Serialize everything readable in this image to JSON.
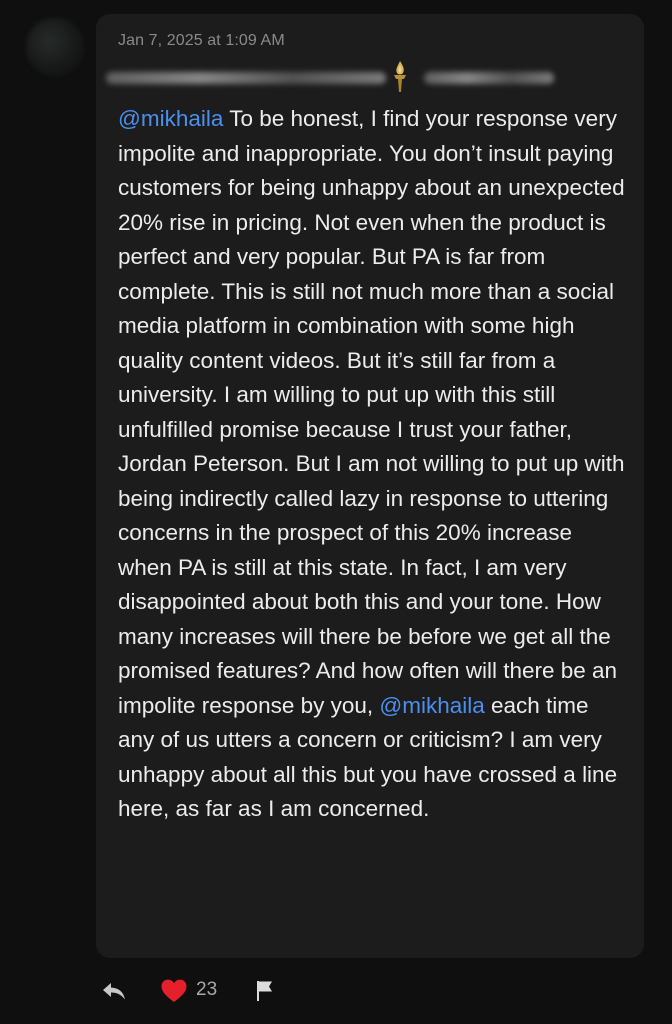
{
  "post": {
    "timestamp": "Jan 7, 2025 at 1:09 AM",
    "message": {
      "mention_1": "@mikhaila",
      "text_1": " To be honest, I find your response very impolite and inappropriate. You don’t insult paying customers for being unhappy about an unexpected 20% rise in pricing. Not even when the product is perfect and very popular. But PA is far from complete. This is still not much more than a social media platform in combination with some high quality content videos. But it’s still far from a university. I am willing to put up with this still unfulfilled promise because I trust your father, Jordan Peterson. But I am not willing to put up with being indirectly called lazy in response to uttering concerns in the prospect of this 20% increase when PA is still at this state. In fact, I am very disappointed about both this and your tone. How many increases will there be before we get all the promised features? And how often will there be an impolite response by you, ",
      "mention_2": "@mikhaila",
      "text_2": " each time any of us utters a concern or criticism? I am very unhappy about all this but you have crossed a line here, as far as I am concerned."
    }
  },
  "actions": {
    "like_count": "23",
    "reply_icon": "reply-arrow-icon",
    "like_icon": "heart-icon",
    "flag_icon": "flag-icon"
  },
  "colors": {
    "background": "#0f0f0f",
    "bubble": "#1c1c1c",
    "text": "#ececec",
    "mention": "#4c8ff0",
    "heart": "#e5202a",
    "muted": "#8a8a8a",
    "torch": "#c9a24a"
  }
}
